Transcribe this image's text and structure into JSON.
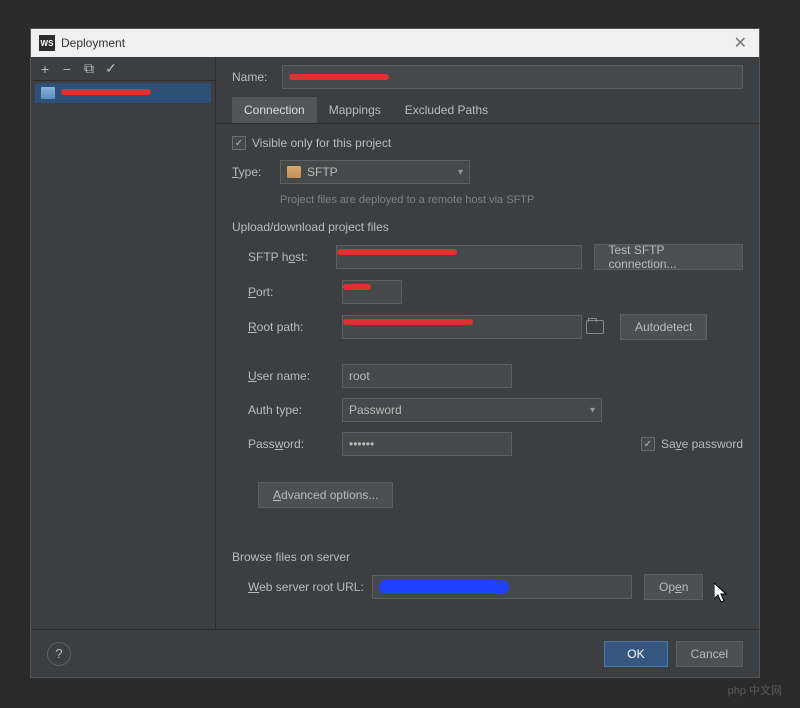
{
  "window": {
    "icon_text": "WS",
    "title": "Deployment"
  },
  "sidebar": {
    "toolbar": {
      "add": "+",
      "remove": "−",
      "copy": "⧉",
      "check": "✓"
    },
    "server_name": "[redacted]"
  },
  "main": {
    "name_label": "Name:",
    "name_value": "[redacted]",
    "tabs": [
      {
        "label": "Connection"
      },
      {
        "label": "Mappings"
      },
      {
        "label": "Excluded Paths"
      }
    ],
    "visible_only": "Visible only for this project",
    "type_label": "Type:",
    "type_value": "SFTP",
    "hint": "Project files are deployed to a remote host via SFTP",
    "section_upload": "Upload/download project files",
    "sftp_host_label": "SFTP host:",
    "test_btn": "Test SFTP connection...",
    "port_label": "Port:",
    "root_path_label": "Root path:",
    "autodetect_btn": "Autodetect",
    "user_name_label": "User name:",
    "user_name_value": "root",
    "auth_type_label": "Auth type:",
    "auth_type_value": "Password",
    "password_label": "Password:",
    "password_value": "••••••",
    "save_password": "Save password",
    "advanced_btn": "Advanced options...",
    "section_browse": "Browse files on server",
    "web_root_label": "Web server root URL:",
    "open_btn": "Open"
  },
  "footer": {
    "help": "?",
    "ok": "OK",
    "cancel": "Cancel"
  },
  "watermark": "php 中文网"
}
